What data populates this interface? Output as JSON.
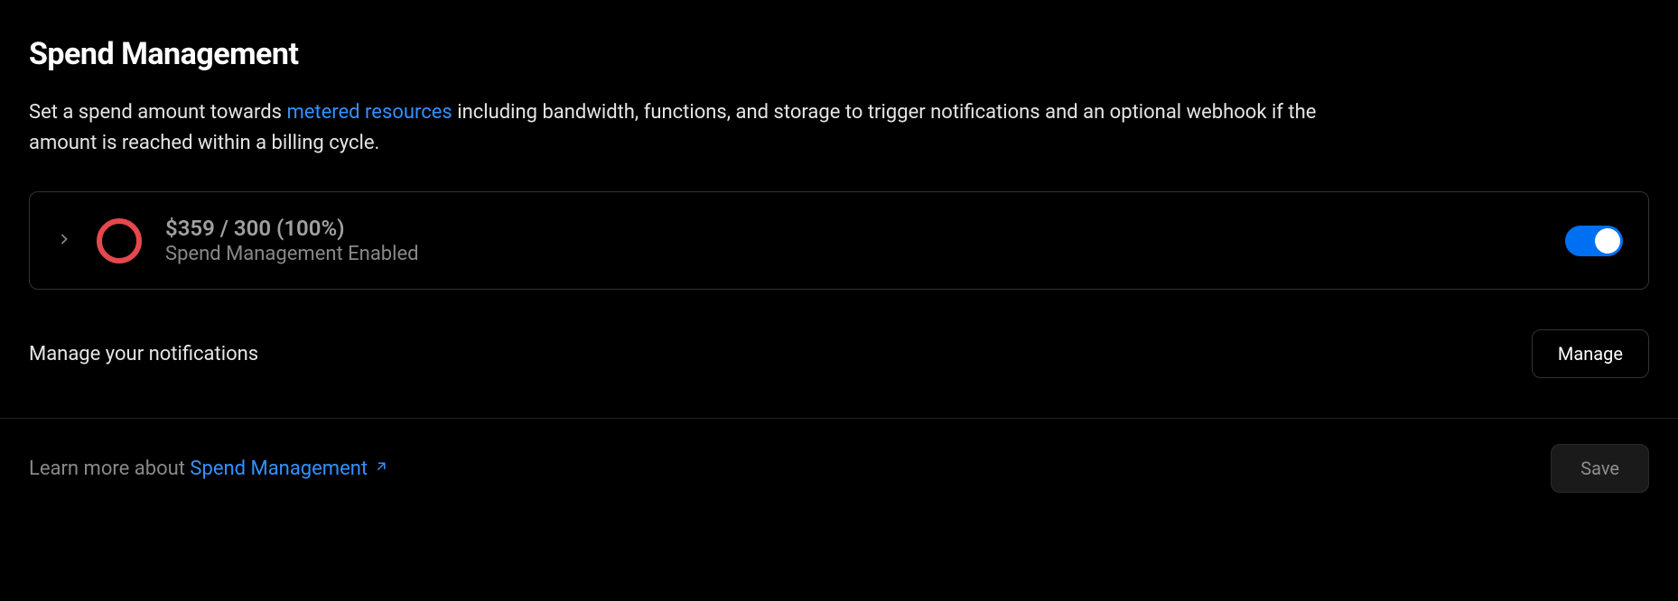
{
  "title": "Spend Management",
  "description": {
    "part1": "Set a spend amount towards ",
    "link": "metered resources",
    "part2": " including bandwidth, functions, and storage to trigger notifications and an optional webhook if the amount is reached within a billing cycle."
  },
  "status": {
    "amount": "$359 / 300 (100%)",
    "label": "Spend Management Enabled",
    "toggle_on": true
  },
  "notifications": {
    "label": "Manage your notifications",
    "button": "Manage"
  },
  "footer": {
    "prefix": "Learn more about ",
    "link": "Spend Management",
    "save": "Save"
  }
}
